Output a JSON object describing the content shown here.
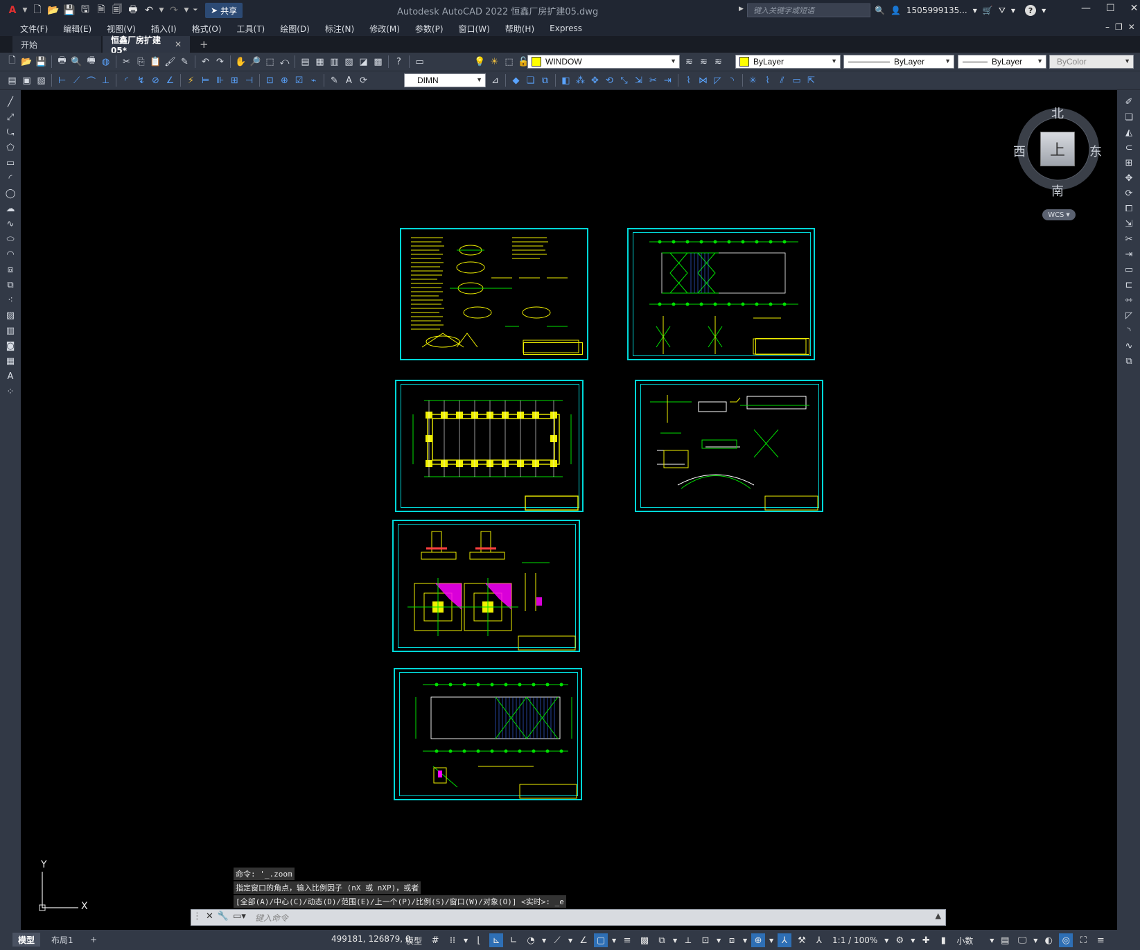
{
  "window": {
    "app_title": "Autodesk AutoCAD 2022    恒鑫厂房扩建05.dwg",
    "share_label": "共享",
    "search_placeholder": "键入关键字或短语",
    "user_account": "1505999135...",
    "minimize_glyph": "—",
    "maximize_glyph": "☐",
    "close_glyph": "✕"
  },
  "menu": [
    "文件(F)",
    "编辑(E)",
    "视图(V)",
    "插入(I)",
    "格式(O)",
    "工具(T)",
    "绘图(D)",
    "标注(N)",
    "修改(M)",
    "参数(P)",
    "窗口(W)",
    "帮助(H)",
    "Express"
  ],
  "tabs": {
    "start": "开始",
    "drawing": "恒鑫厂房扩建05*",
    "close_glyph": "✕",
    "add_glyph": "+"
  },
  "toolbar": {
    "layer_value": "WINDOW",
    "color_value": "ByLayer",
    "linetype_value": "ByLayer",
    "lineweight_value": "ByLayer",
    "plotstyle_value": "ByColor",
    "dimstyle_value": "DIMN"
  },
  "viewcube": {
    "north": "北",
    "south": "南",
    "east": "东",
    "west": "西",
    "top": "上",
    "wcs": "WCS"
  },
  "ucs": {
    "x_label": "X",
    "y_label": "Y"
  },
  "command": {
    "history": [
      "命令: '_.zoom",
      "指定窗口的角点，输入比例因子 (nX 或 nXP)，或者",
      "[全部(A)/中心(C)/动态(D)/范围(E)/上一个(P)/比例(S)/窗口(W)/对象(O)] <实时>: _e"
    ],
    "input_placeholder": "键入命令"
  },
  "status": {
    "model_tab": "模型",
    "layout_tab": "布局1",
    "add_tab": "+",
    "coordinates": "499181, 126879, 0",
    "model_space": "模型",
    "scale": "1:1 / 100%",
    "units": "小数"
  },
  "colors": {
    "sheet_border": "#00d8d8",
    "drawing_yellow": "#f0f000",
    "drawing_green": "#00e000",
    "drawing_magenta": "#ff00ff",
    "accent_blue": "#2e6fb5"
  }
}
